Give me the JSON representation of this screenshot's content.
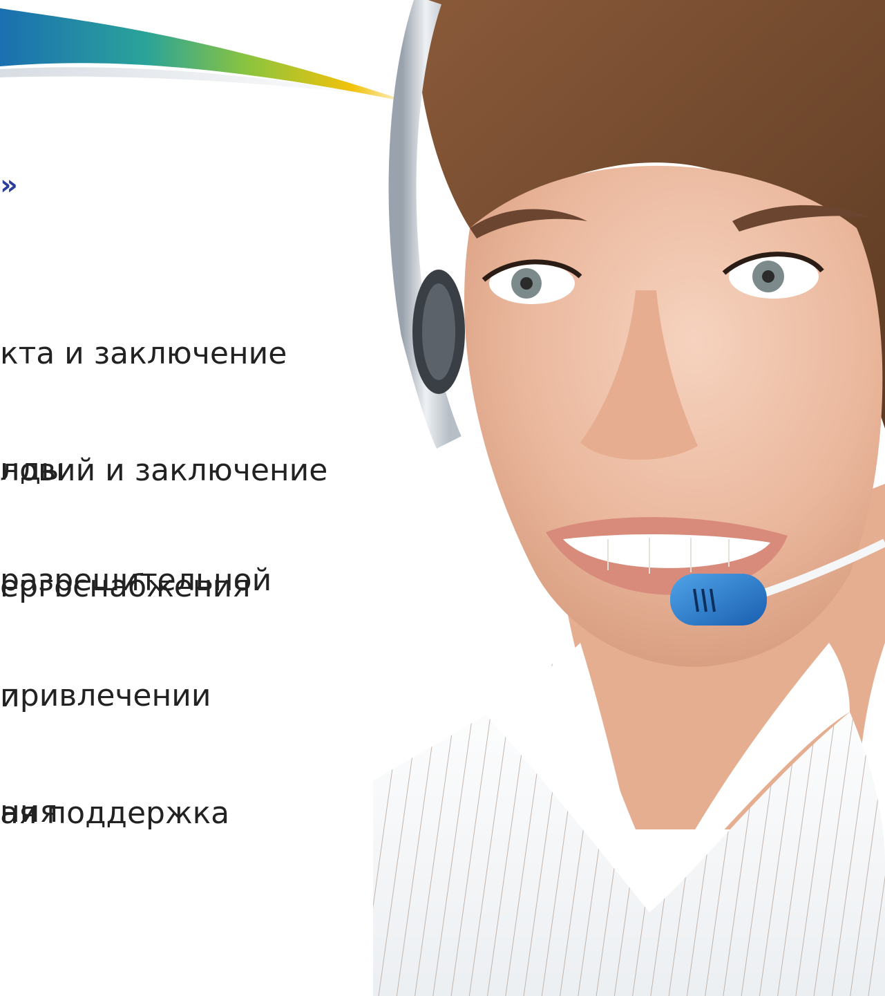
{
  "slide": {
    "title_fragment": "»",
    "items": [
      {
        "line1": "кта и заключение",
        "line2": "нды"
      },
      {
        "line1": "ловий и заключение",
        "line2": "ергоснабжения"
      },
      {
        "line1": "разрешительной",
        "line2": "и"
      },
      {
        "line1": "привлечении",
        "line2": "ния"
      },
      {
        "line1": "ая поддержка",
        "line2": ""
      }
    ]
  },
  "photo": {
    "subject": "smiling-operator-with-headset"
  },
  "colors": {
    "accent_blue": "#2a3f9c",
    "swoosh_start": "#1b6fb0",
    "swoosh_mid": "#6fb84a",
    "swoosh_end": "#f2c20a"
  }
}
